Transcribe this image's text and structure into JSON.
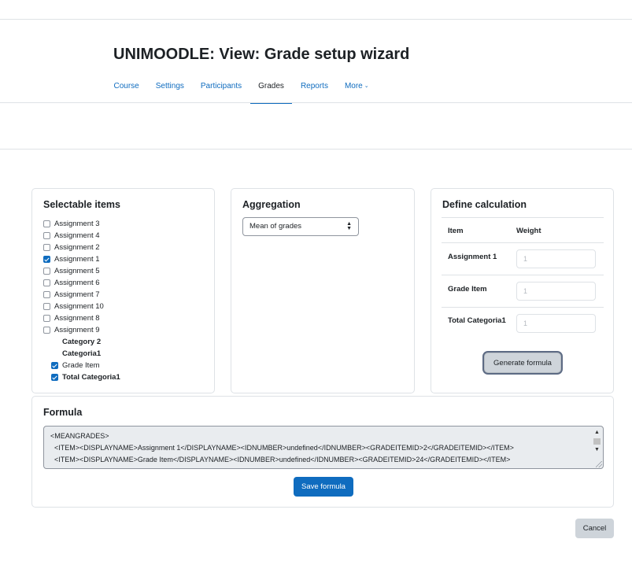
{
  "header": {
    "title": "UNIMOODLE: View: Grade setup wizard"
  },
  "nav": {
    "items": [
      {
        "label": "Course",
        "active": false
      },
      {
        "label": "Settings",
        "active": false
      },
      {
        "label": "Participants",
        "active": false
      },
      {
        "label": "Grades",
        "active": true
      },
      {
        "label": "Reports",
        "active": false
      },
      {
        "label": "More",
        "active": false,
        "icon": "chevron-down-icon",
        "caret": "⌄"
      }
    ]
  },
  "selectable": {
    "title": "Selectable items",
    "items": [
      {
        "label": "Assignment 3",
        "checked": false
      },
      {
        "label": "Assignment 4",
        "checked": false
      },
      {
        "label": "Assignment 2",
        "checked": false
      },
      {
        "label": "Assignment 1",
        "checked": true
      },
      {
        "label": "Assignment 5",
        "checked": false
      },
      {
        "label": "Assignment 6",
        "checked": false
      },
      {
        "label": "Assignment 7",
        "checked": false
      },
      {
        "label": "Assignment 10",
        "checked": false
      },
      {
        "label": "Assignment 8",
        "checked": false
      },
      {
        "label": "Assignment 9",
        "checked": false
      }
    ],
    "categories": [
      {
        "label": "Category 2"
      },
      {
        "label": "Categoria1"
      }
    ],
    "sub_items": [
      {
        "label": "Grade Item",
        "checked": true
      },
      {
        "label": "Total Categoria1",
        "checked": true
      }
    ]
  },
  "aggregation": {
    "title": "Aggregation",
    "selected": "Mean of grades",
    "arrow_up": "▲",
    "arrow_down": "▼"
  },
  "calculation": {
    "title": "Define calculation",
    "headers": {
      "item": "Item",
      "weight": "Weight"
    },
    "rows": [
      {
        "item": "Assignment 1",
        "weight_placeholder": "1"
      },
      {
        "item": "Grade Item",
        "weight_placeholder": "1"
      },
      {
        "item": "Total Categoria1",
        "weight_placeholder": "1"
      }
    ],
    "generate_label": "Generate formula"
  },
  "formula": {
    "title": "Formula",
    "lines": [
      "<MEANGRADES>",
      "  <ITEM><DISPLAYNAME>Assignment 1</DISPLAYNAME><IDNUMBER>undefined</IDNUMBER><GRADEITEMID>2</GRADEITEMID></ITEM>",
      "  <ITEM><DISPLAYNAME>Grade Item</DISPLAYNAME><IDNUMBER>undefined</IDNUMBER><GRADEITEMID>24</GRADEITEMID></ITEM>"
    ],
    "scroll_up": "▲",
    "scroll_down": "▼",
    "save_label": "Save formula"
  },
  "footer": {
    "cancel_label": "Cancel"
  },
  "colors": {
    "primary": "#0f6cbf",
    "secondary": "#ced4da",
    "border": "#dee2e6",
    "text": "#1d2125"
  }
}
